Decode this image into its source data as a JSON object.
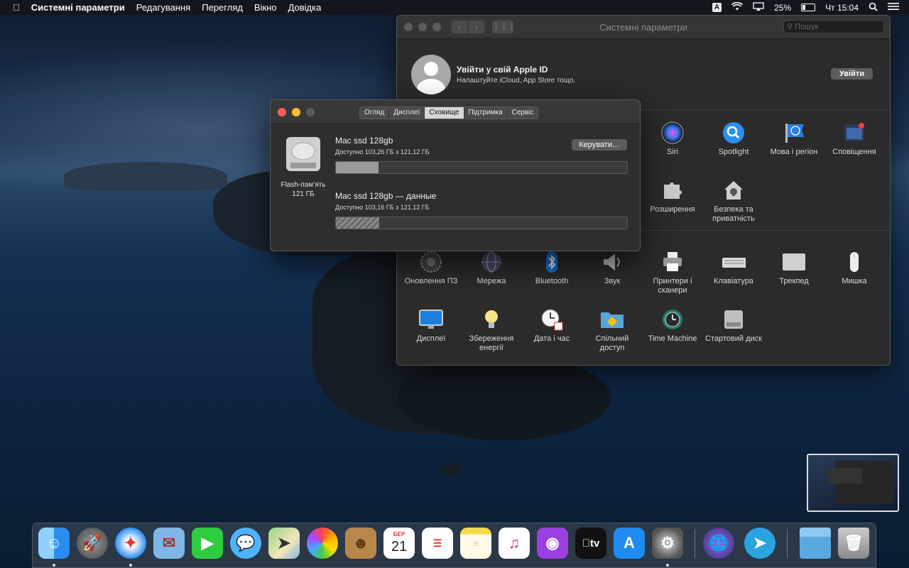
{
  "menubar": {
    "app_name": "Системні параметри",
    "items": [
      "Редагування",
      "Перегляд",
      "Вікно",
      "Довідка"
    ],
    "input_badge": "A",
    "battery": "25%",
    "clock": "Чт 15:04"
  },
  "syspref": {
    "title": "Системні параметри",
    "search_placeholder": "Пошук",
    "apple_id_title": "Увійти у свій Apple ID",
    "apple_id_sub": "Налаштуйте iCloud, App Store тощо.",
    "signin_label": "Увійти",
    "prefs": {
      "siri": "Siri",
      "spotlight": "Spotlight",
      "language": "Мова і регіон",
      "notifications": "Сповіщення",
      "extensions": "Розширення",
      "security": "Безпека та приватність",
      "update": "Оновлення ПЗ",
      "network": "Мережа",
      "bluetooth": "Bluetooth",
      "sound": "Звук",
      "printers": "Принтери і сканери",
      "keyboard": "Клавіатура",
      "trackpad": "Трекпед",
      "mouse": "Мишка",
      "displays": "Дисплеї",
      "energy": "Збереження енергії",
      "datetime": "Дата і час",
      "sharing": "Спільний доступ",
      "timemachine": "Time Machine",
      "startup": "Стартовий диск"
    }
  },
  "about": {
    "tabs": [
      "Огляд",
      "Дисплеї",
      "Сховище",
      "Підтримка",
      "Сервіс"
    ],
    "active_tab": "Сховище",
    "disk_label": "Flash-пам’ять",
    "disk_size": "121 ГБ",
    "manage_label": "Керувати…",
    "volumes": [
      {
        "name": "Mac ssd 128gb",
        "available": "Доступно 103,26 ГБ з 121,12 ГБ",
        "used_fraction": 0.147
      },
      {
        "name": "Mac ssd 128gb — данные",
        "available": "Доступно 103,16 ГБ з 121,12 ГБ",
        "used_fraction": 0.148
      }
    ]
  },
  "dock": {
    "calendar_month": "БЕР",
    "calendar_day": "21",
    "tv_label": "tv",
    "apps": [
      "finder-icon",
      "launchpad-icon",
      "safari-icon",
      "mail-icon",
      "facetime-icon",
      "messages-icon",
      "maps-icon",
      "photos-icon",
      "contacts-icon",
      "calendar-icon",
      "reminders-icon",
      "notes-icon",
      "music-icon",
      "podcasts-icon",
      "tv-icon",
      "appstore-icon",
      "system-preferences-icon",
      "network-radar-icon",
      "telegram-icon",
      "folder-icon",
      "trash-icon"
    ]
  },
  "colors": {
    "close": "#ff5f57",
    "minimize": "#febc2e",
    "zoom": "#5c5c5c"
  }
}
